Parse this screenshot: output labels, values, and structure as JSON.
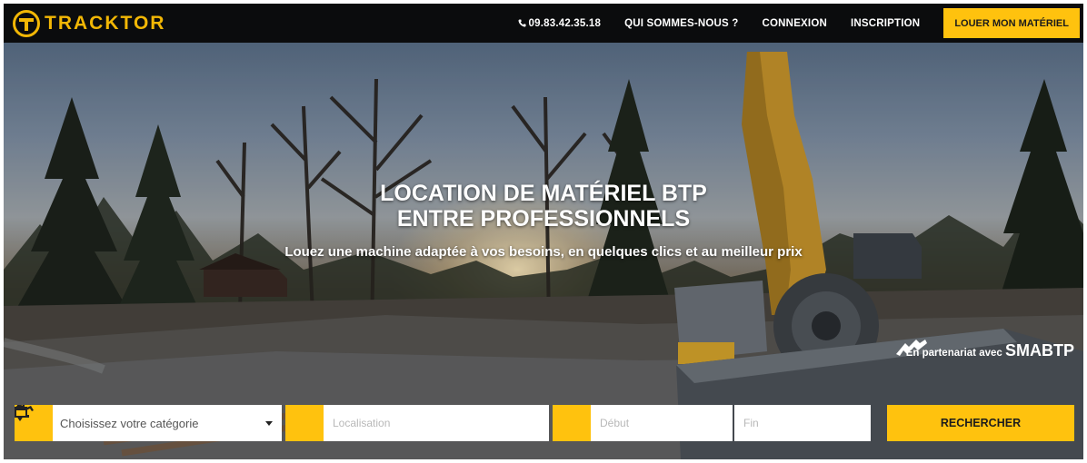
{
  "brand": {
    "name": "TRACKTOR"
  },
  "nav": {
    "phone": "09.83.42.35.18",
    "links": [
      "QUI SOMMES-NOUS ?",
      "CONNEXION",
      "INSCRIPTION"
    ],
    "cta": "LOUER MON MATÉRIEL"
  },
  "hero": {
    "title_line1": "LOCATION DE MATÉRIEL BTP",
    "title_line2": "ENTRE PROFESSIONNELS",
    "subtitle": "Louez une machine adaptée à vos besoins, en quelques clics et au meilleur prix",
    "partner_prefix": "En partenariat avec",
    "partner_name": "SMABTP"
  },
  "search": {
    "category_value": "Choisissez votre catégorie",
    "location_placeholder": "Localisation",
    "start_placeholder": "Début",
    "end_placeholder": "Fin",
    "submit_label": "RECHERCHER"
  },
  "colors": {
    "accent": "#ffc20e",
    "navbar": "#0b0c0d",
    "logo": "#f2b705"
  },
  "icons": [
    "logo-icon",
    "phone-icon",
    "excavator-icon",
    "map-pin-icon",
    "calendar-icon",
    "chevron-down-icon",
    "smabtp-logo-icon"
  ]
}
